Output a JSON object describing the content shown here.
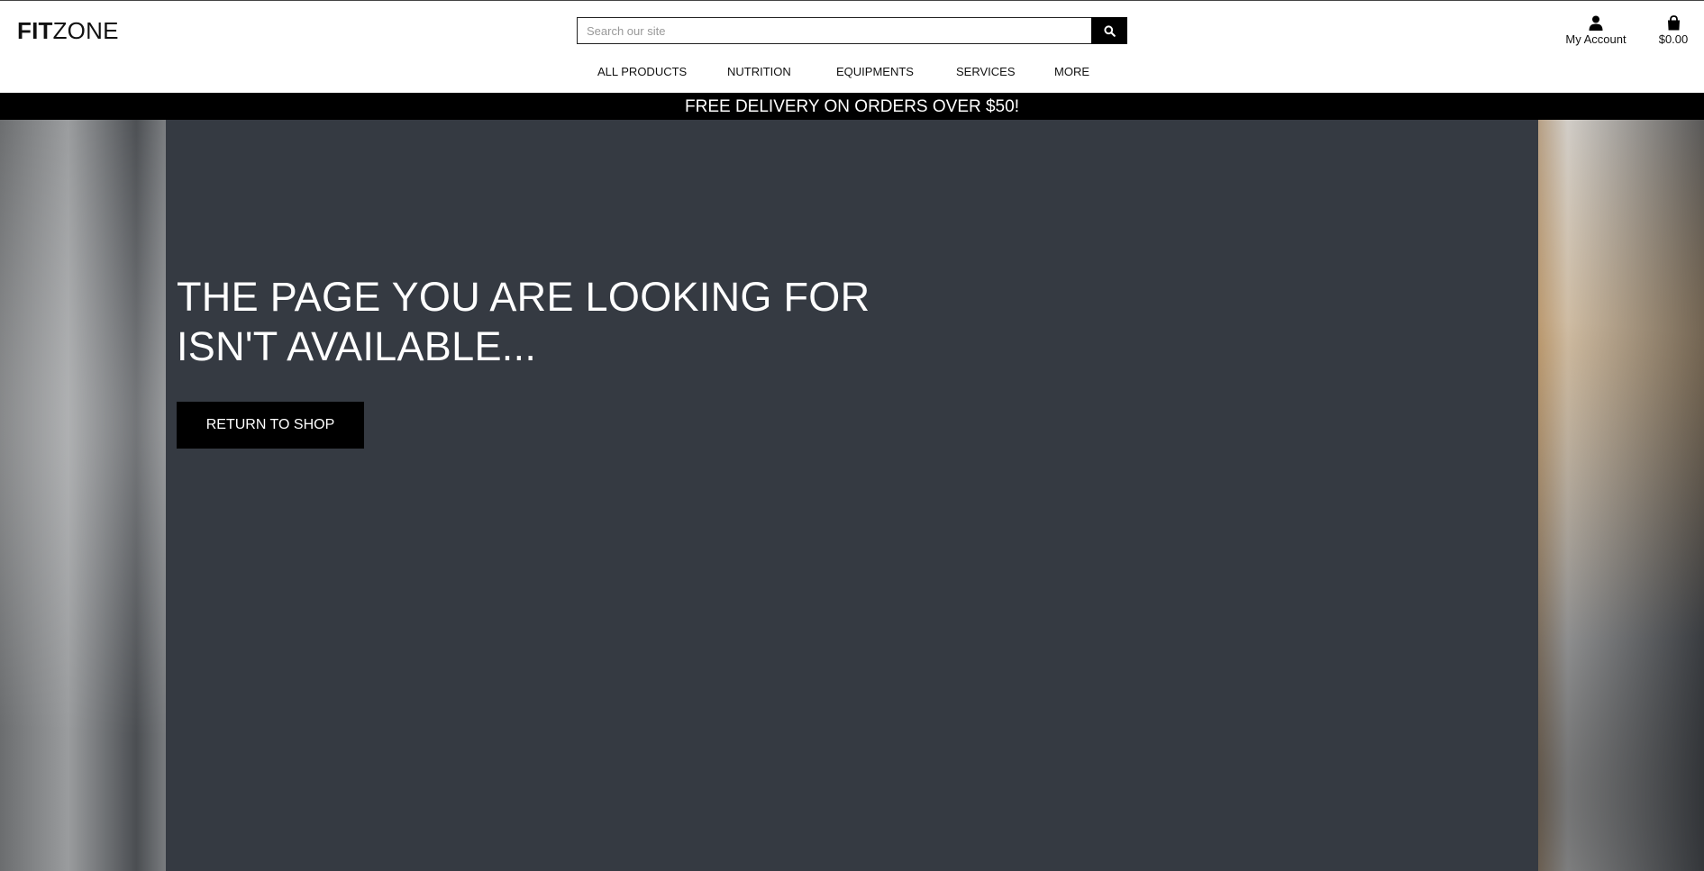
{
  "header": {
    "logo_bold": "FIT",
    "logo_light": "ZONE",
    "search": {
      "placeholder": "Search our site",
      "value": ""
    },
    "search_icon": "search-icon",
    "account": {
      "icon": "user-icon",
      "label": "My Account"
    },
    "cart": {
      "icon": "shopping-bag-icon",
      "label": "$0.00"
    }
  },
  "nav": {
    "items": [
      {
        "label": "ALL PRODUCTS"
      },
      {
        "label": "NUTRITION"
      },
      {
        "label": "EQUIPMENTS"
      },
      {
        "label": "SERVICES"
      },
      {
        "label": "MORE"
      }
    ]
  },
  "banner": {
    "text": "FREE DELIVERY ON ORDERS OVER $50!"
  },
  "main": {
    "heading_line1": "THE PAGE YOU ARE LOOKING FOR",
    "heading_line2": "ISN'T AVAILABLE...",
    "button_label": "RETURN TO SHOP"
  },
  "colors": {
    "overlay": "#353a42",
    "banner_bg": "#000000",
    "button_bg": "#000000",
    "text_light": "#ffffff"
  }
}
